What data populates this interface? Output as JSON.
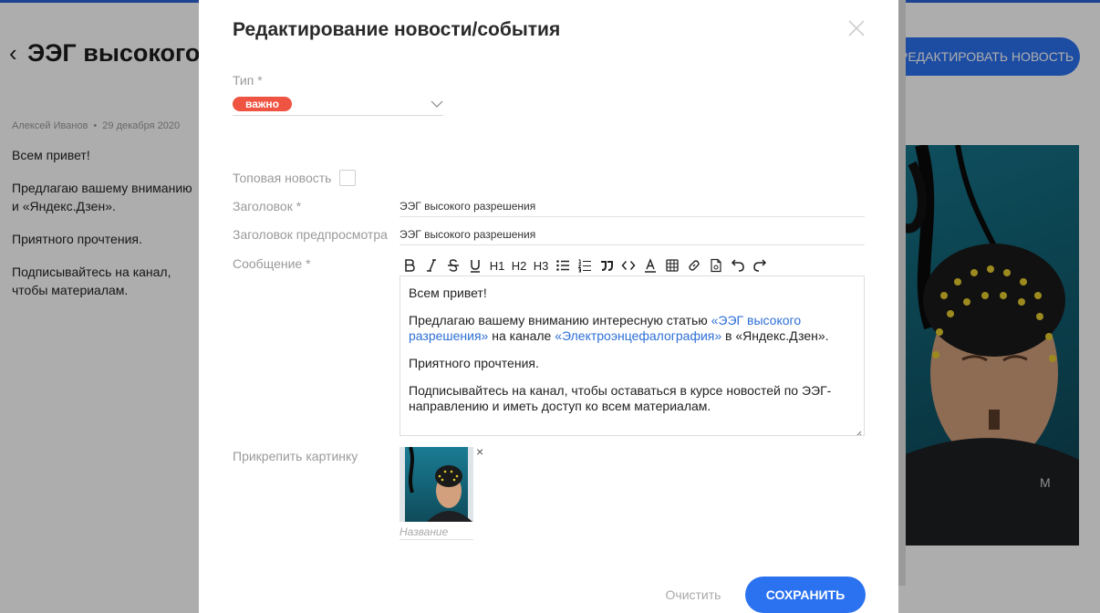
{
  "background": {
    "title": "ЭЭГ высокого",
    "edit_button": "РЕДАКТИРОВАТЬ НОВОСТЬ",
    "author": "Алексей Иванов",
    "date": "29 декабря 2020",
    "paragraphs": [
      "Всем привет!",
      "Предлагаю вашему вниманию и «Яндекс.Дзен».",
      "Приятного прочтения.",
      "Подписывайтесь на канал, чтобы материалам."
    ]
  },
  "modal": {
    "title": "Редактирование новости/события",
    "type_label": "Тип *",
    "type_value": "важно",
    "top_news_label": "Топовая новость",
    "top_news_checked": false,
    "heading_label": "Заголовок *",
    "heading_value": "ЭЭГ высокого разрешения",
    "preview_label": "Заголовок предпросмотра",
    "preview_value": "ЭЭГ высокого разрешения",
    "message_label": "Сообщение *",
    "toolbar": {
      "h1": "H1",
      "h2": "H2",
      "h3": "H3"
    },
    "editor": {
      "p1": "Всем привет!",
      "p2_before": "Предлагаю вашему вниманию интересную статью ",
      "p2_link1": "«ЭЭГ высокого разрешения»",
      "p2_middle": " на канале ",
      "p2_link2": "«Электроэнцефалография»",
      "p2_after": " в «Яндекс.Дзен».",
      "p3": "Приятного прочтения.",
      "p4": "Подписывайтесь на канал, чтобы оставаться в курсе новостей по ЭЭГ-направлению и иметь доступ ко всем материалам."
    },
    "attach_label": "Прикрепить картинку",
    "remove_symbol": "×",
    "image_caption_placeholder": "Название",
    "clear_button": "Очистить",
    "save_button": "СОХРАНИТЬ"
  },
  "colors": {
    "accent": "#2b72f0",
    "badge": "#ef5442",
    "link": "#2d6fd6"
  }
}
